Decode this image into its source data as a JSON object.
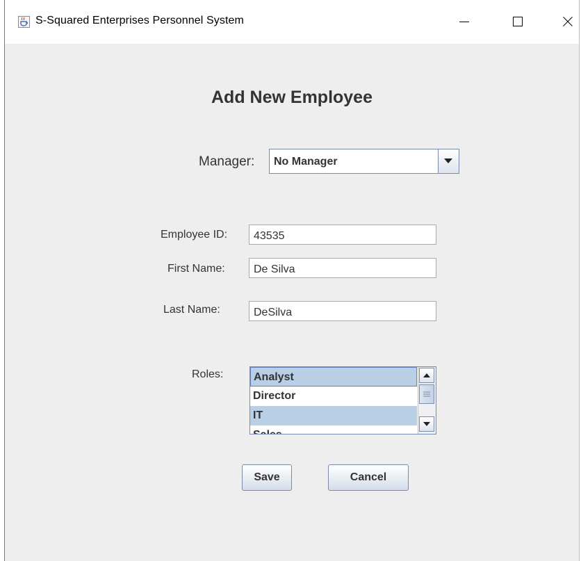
{
  "window": {
    "title": "S-Squared Enterprises Personnel System",
    "icon": "java-coffee-cup-icon"
  },
  "form": {
    "heading": "Add New Employee",
    "manager": {
      "label": "Manager:",
      "selected": "No Manager"
    },
    "employee_id": {
      "label": "Employee ID:",
      "value": "43535"
    },
    "first_name": {
      "label": "First Name:",
      "value": "De Silva"
    },
    "last_name": {
      "label": "Last Name:",
      "value": "DeSilva"
    },
    "roles": {
      "label": "Roles:",
      "items": [
        {
          "label": "Analyst",
          "selected": true
        },
        {
          "label": "Director",
          "selected": false
        },
        {
          "label": "IT",
          "selected": true
        },
        {
          "label": "Sales",
          "selected": false
        }
      ]
    }
  },
  "buttons": {
    "save": "Save",
    "cancel": "Cancel"
  },
  "colors": {
    "background": "#eeeeee",
    "selection": "#b8cfe5",
    "text": "#333333"
  }
}
